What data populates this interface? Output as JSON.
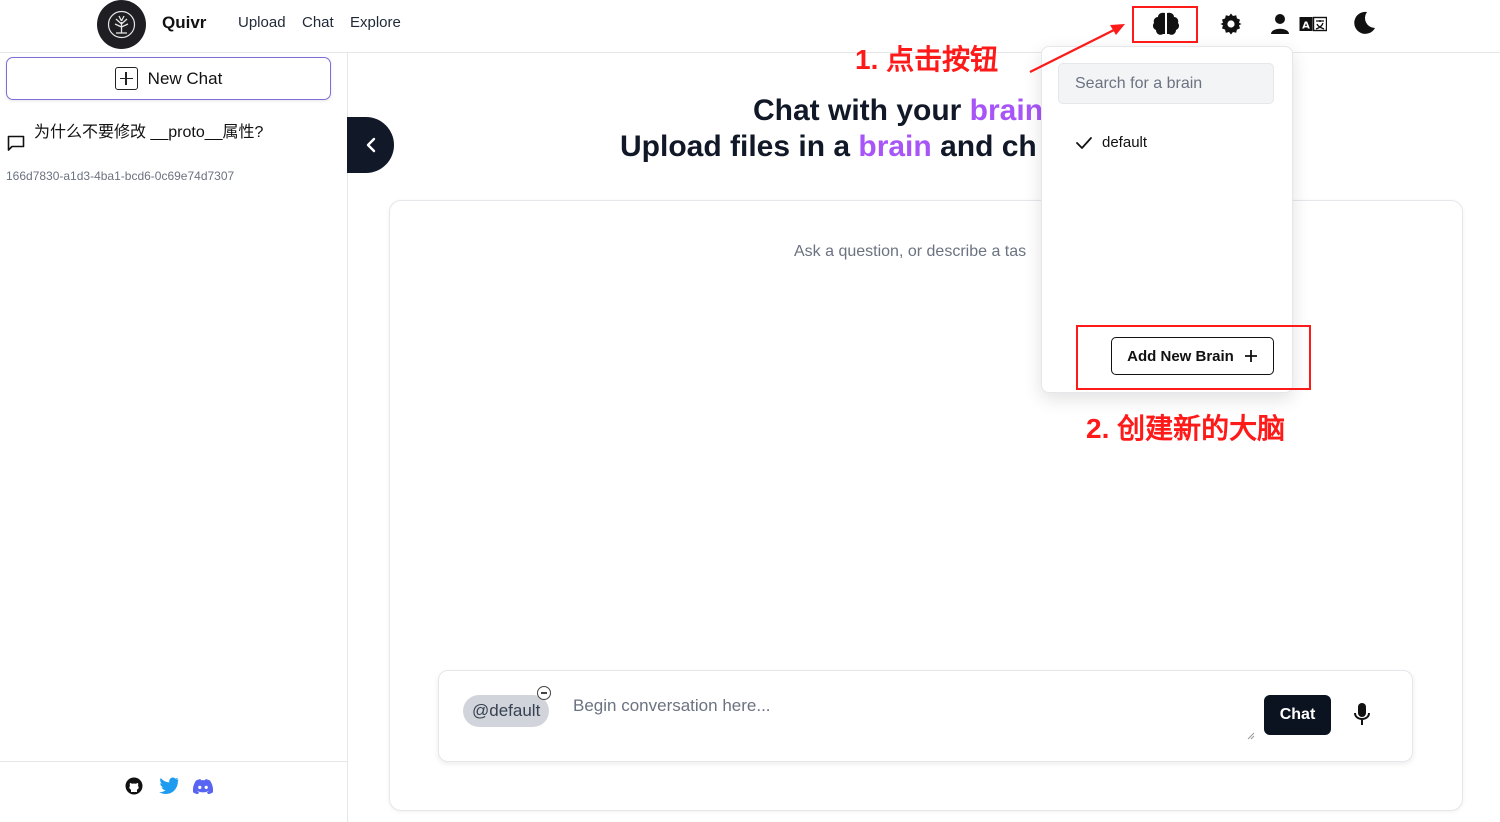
{
  "header": {
    "brand": "Quivr",
    "nav": [
      "Upload",
      "Chat",
      "Explore"
    ],
    "icons": [
      "brain-icon",
      "gear-icon",
      "user-icon",
      "translate-icon",
      "moon-icon"
    ]
  },
  "sidebar": {
    "new_chat_label": "New Chat",
    "chats": [
      {
        "title": "为什么不要修改 __proto__属性?",
        "id": "166d7830-a1d3-4ba1-bcd6-0c69e74d7307"
      }
    ],
    "footer_icons": [
      "github-icon",
      "twitter-icon",
      "discord-icon"
    ]
  },
  "main": {
    "heading_line1_prefix": "Chat with your ",
    "heading_line1_accent": "brain",
    "heading_line2_prefix": "Upload files in a ",
    "heading_line2_accent": "brain",
    "heading_line2_suffix": " and ch",
    "ask_text": "Ask a question, or describe a tas",
    "brain_tag": "@default",
    "input_placeholder": "Begin conversation here...",
    "send_label": "Chat"
  },
  "brain_dropdown": {
    "search_placeholder": "Search for a brain",
    "options": [
      {
        "label": "default",
        "selected": true
      }
    ],
    "add_label": "Add New Brain"
  },
  "annotations": {
    "step1": "1. 点击按钮",
    "step2": "2. 创建新的大脑"
  },
  "colors": {
    "accent": "#a855f7",
    "annotation": "#ff1a1a",
    "dark_button": "#0b1220"
  }
}
